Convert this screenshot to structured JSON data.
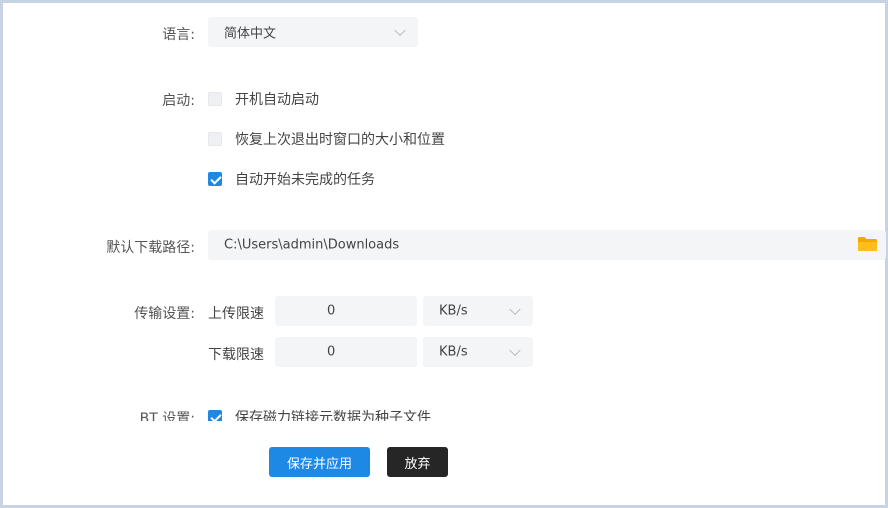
{
  "language": {
    "label": "语言:",
    "selected": "简体中文"
  },
  "startup": {
    "label": "启动:",
    "options": [
      {
        "label": "开机自动启动",
        "checked": false
      },
      {
        "label": "恢复上次退出时窗口的大小和位置",
        "checked": false
      },
      {
        "label": "自动开始未完成的任务",
        "checked": true
      }
    ]
  },
  "download_path": {
    "label": "默认下载路径:",
    "value": "C:\\Users\\admin\\Downloads",
    "browse_icon": "folder-icon"
  },
  "transfer": {
    "label": "传输设置:",
    "upload": {
      "label": "上传限速",
      "value": "0",
      "unit": "KB/s"
    },
    "download": {
      "label": "下载限速",
      "value": "0",
      "unit": "KB/s"
    }
  },
  "bt": {
    "label": "BT 设置:",
    "option": {
      "label": "保存磁力链接元数据为种子文件",
      "checked": true
    }
  },
  "footer": {
    "save_label": "保存并应用",
    "discard_label": "放弃"
  },
  "colors": {
    "primary": "#1e88e5",
    "dark_button": "#262626",
    "field_bg": "#f4f5f7",
    "folder": "#f5a800"
  }
}
